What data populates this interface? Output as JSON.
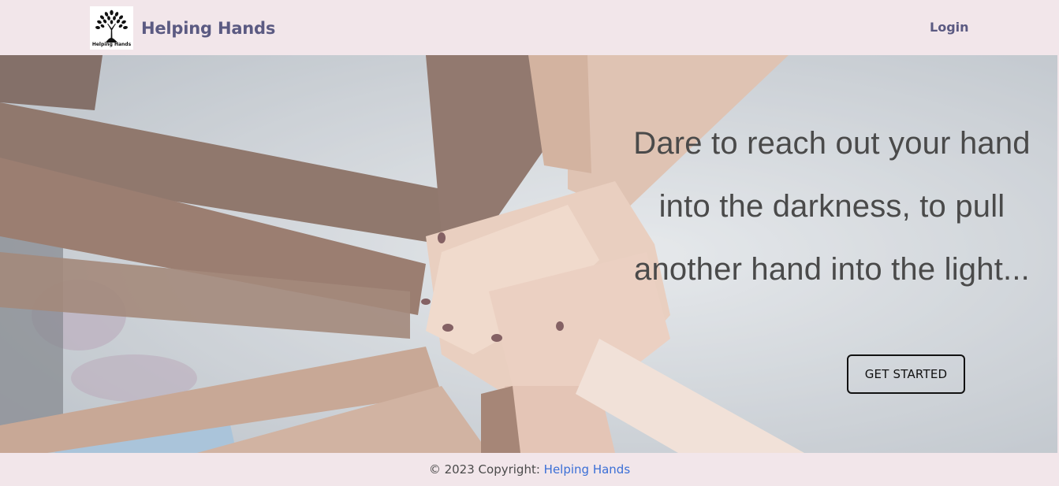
{
  "navbar": {
    "brand_name": "Helping Hands",
    "logo_text": "Helping Hands",
    "login_label": "Login"
  },
  "hero": {
    "quote_line1": "Dare to reach out your hand",
    "quote_line2": "into the darkness, to pull",
    "quote_line3": "another hand into the light...",
    "cta_label": "GET STARTED"
  },
  "footer": {
    "copyright_prefix": "© 2023 Copyright:",
    "copyright_link": "Helping Hands"
  },
  "colors": {
    "background": "#f2e6ea",
    "brand": "#5b5a82",
    "link": "#3b6fd6",
    "text": "#4a4a4a"
  }
}
